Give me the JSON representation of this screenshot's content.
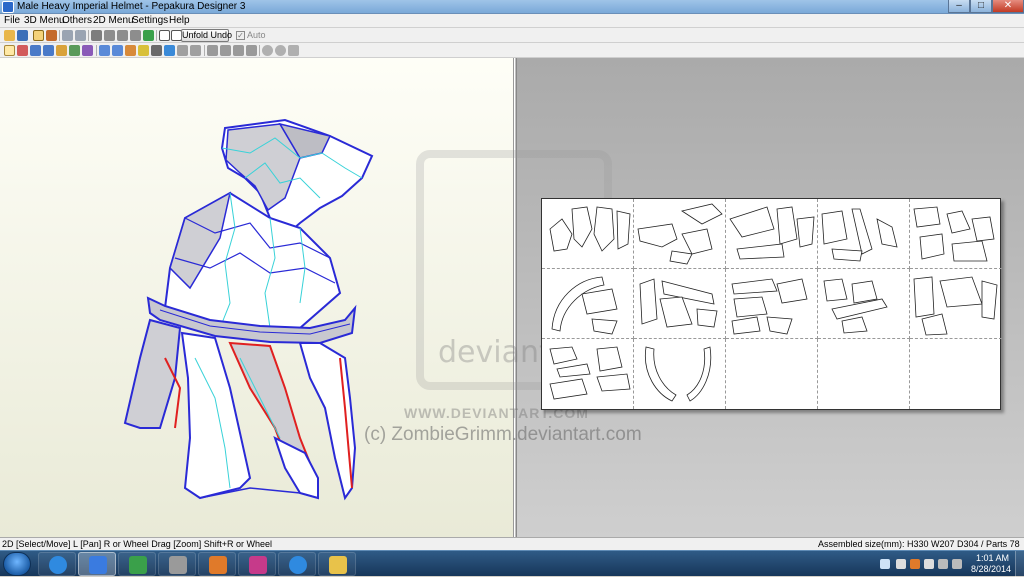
{
  "window": {
    "title": "Male Heavy Imperial Helmet - Pepakura Designer 3",
    "minimize": "–",
    "maximize": "□",
    "close": "✕"
  },
  "menu": {
    "items": [
      "File",
      "3D Menu",
      "Others",
      "2D Menu",
      "Settings",
      "Help"
    ]
  },
  "toolbar": {
    "unfold_undo_label": "Unfold Undo",
    "auto_label": "Auto",
    "auto_checked": true
  },
  "status": {
    "left": "2D [Select/Move] L [Pan] R or Wheel Drag [Zoom] Shift+R or Wheel",
    "right": "Assembled size(mm): H330 W207 D304 / Parts 78"
  },
  "watermark": {
    "logo_text": "deviantART",
    "url": "WWW.DEVIANTART.COM",
    "credit": "(c) ZombieGrimm.deviantart.com"
  },
  "taskbar": {
    "clock_time": "1:01 AM",
    "clock_date": "8/28/2014"
  },
  "colors": {
    "mesh_line": "#2a2ad6",
    "fold_line": "#38d2d8",
    "edge_red": "#e02020",
    "face_gray": "#cfcfd4"
  }
}
